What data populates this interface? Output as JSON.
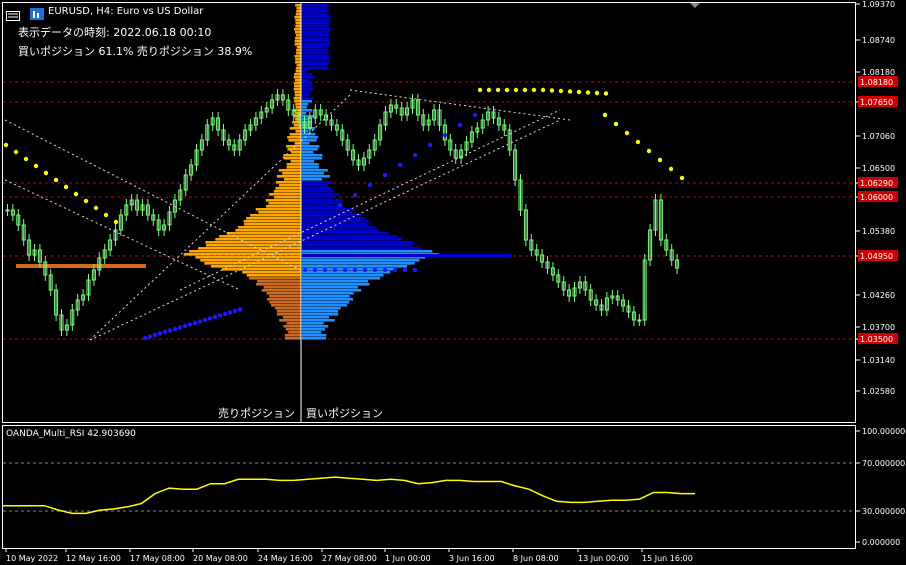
{
  "window": {
    "title": "EURUSD, H4:  Euro vs US Dollar",
    "data_time_label": "表示データの時刻: 2022.06.18 00:10",
    "position_summary": "買いポジション 61.1% 売りポジション 38.9%",
    "sell_label": "売りポジション",
    "buy_label": "買いポジション"
  },
  "indicator": {
    "title": "OANDA_Multi_RSI 42.903690",
    "axis_ticks": [
      "100.000000",
      "70.000000",
      "30.000000",
      "0.000000"
    ],
    "series_color": "#ffff00",
    "values": [
      33,
      33,
      33,
      33,
      29,
      26,
      26,
      29,
      30,
      32,
      35,
      44,
      49,
      48,
      48,
      53,
      53,
      57,
      57,
      57,
      56,
      56,
      57,
      58,
      59,
      58,
      57,
      56,
      57,
      56,
      53,
      54,
      56,
      56,
      55,
      55,
      55,
      51,
      48,
      42,
      37,
      36,
      36,
      37,
      38,
      38,
      39,
      45,
      45,
      44,
      44
    ]
  },
  "price_axis": {
    "ticks": [
      "1.09370",
      "1.08740",
      "1.08180",
      "1.07650",
      "1.07060",
      "1.06500",
      "1.06290",
      "1.05930",
      "1.05380",
      "1.04950",
      "1.04260",
      "1.03700",
      "1.03500",
      "1.03140",
      "1.02580"
    ],
    "level_labels": [
      "1.08180",
      "1.07650",
      "1.06290",
      "1.06000",
      "1.04950",
      "1.03500"
    ],
    "level_color": "#cc0000"
  },
  "time_axis": {
    "ticks": [
      "10 May 2022",
      "12 May 16:00",
      "17 May 08:00",
      "20 May 08:00",
      "24 May 16:00",
      "27 May 08:00",
      "1 Jun 00:00",
      "3 Jun 16:00",
      "8 Jun 08:00",
      "13 Jun 00:00",
      "15 Jun 16:00"
    ]
  },
  "colors": {
    "candle": "#7cfc7c",
    "buy_profile": "#1e90ff",
    "buy_profile_dark": "#0000cd",
    "sell_profile": "#ffa500",
    "sell_profile_dark": "#cd6a1f",
    "order_dot_yellow": "#ffff00",
    "order_dot_blue": "#1a1aff"
  }
}
